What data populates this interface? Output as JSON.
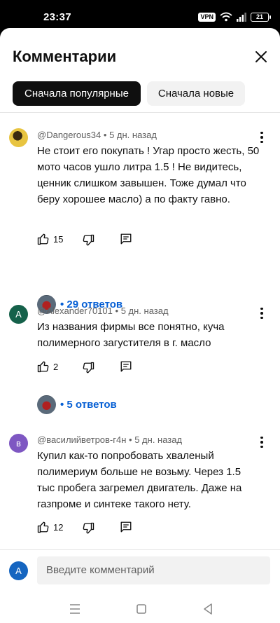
{
  "status": {
    "time": "23:37",
    "vpn": "VPN",
    "battery": "21"
  },
  "sheet": {
    "title": "Комментарии"
  },
  "sort": {
    "popular_label": "Сначала популярные",
    "new_label": "Сначала новые"
  },
  "comments": [
    {
      "author": "@Dangerous34",
      "time": "5 дн. назад",
      "text": "Не стоит его покупать ! Угар просто жесть, 50 мото часов ушло литра 1.5 ! Не видитесь, ценник слишком завышен. Тоже думал что беру хорошее масло) а по факту гавно.",
      "likes": "15",
      "replies": "• 29 ответов"
    },
    {
      "author": "@Alexander70101",
      "time": "5 дн. назад",
      "avatar_letter": "A",
      "text": "Из названия фирмы все понятно, куча полимерного загустителя в г. масло",
      "likes": "2",
      "replies": "• 5 ответов"
    },
    {
      "author": "@василийветров-г4н",
      "time": "5 дн. назад",
      "avatar_letter": "в",
      "text": "Купил как-то попробовать хваленый полимериум больше не возьму. Через 1.5 тыс пробега загремел двигатель. Даже на газпроме и синтеке такого нету.",
      "likes": "12"
    }
  ],
  "compose": {
    "avatar_letter": "A",
    "placeholder": "Введите комментарий"
  },
  "colors": {
    "link": "#065fd4",
    "chip_active": "#0f0f0f",
    "chip_inactive": "#f2f2f2"
  }
}
